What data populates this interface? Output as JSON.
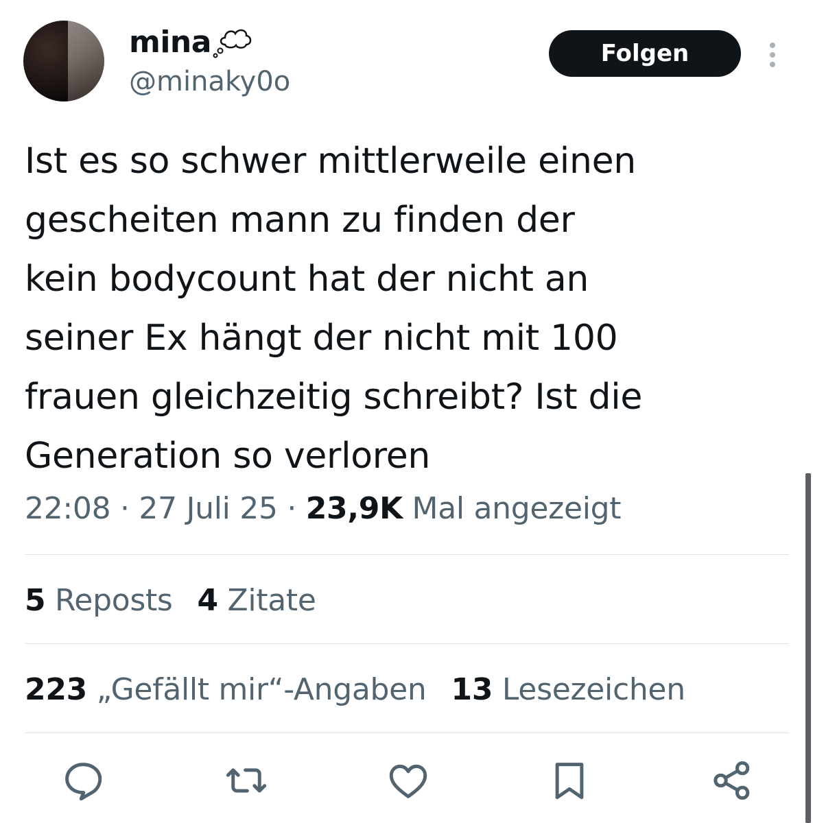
{
  "author": {
    "display_name": "mina",
    "handle": "@minaky0o",
    "follow_label": "Folgen"
  },
  "tweet": {
    "text": "Ist es so schwer mittlerweile einen\ngescheiten mann zu finden der\nkein bodycount hat der nicht an\nseiner Ex hängt der nicht mit 100\nfrauen gleichzeitig schreibt? Ist die\nGeneration so verloren",
    "time": "22:08",
    "separator": " · ",
    "date": "27 Juli 25",
    "views": "23,9K",
    "views_label": " Mal angezeigt"
  },
  "stats": {
    "reposts_count": "5",
    "reposts_label": " Reposts",
    "quotes_count": "4",
    "quotes_label": " Zitate",
    "likes_count": "223",
    "likes_label": " „Gefällt mir“-Angaben",
    "bookmarks_count": "13",
    "bookmarks_label": " Lesezeichen"
  },
  "icons": {
    "reply": "reply-icon",
    "repost": "repost-icon",
    "like": "heart-icon",
    "bookmark": "bookmark-icon",
    "share": "share-icon",
    "more": "more-vertical-icon",
    "name_decoration": "thought-bubble-icon"
  },
  "colors": {
    "text_primary": "#0f1419",
    "text_secondary": "#536471",
    "follow_bg": "#0f1419",
    "divider": "#dfe3e6"
  }
}
